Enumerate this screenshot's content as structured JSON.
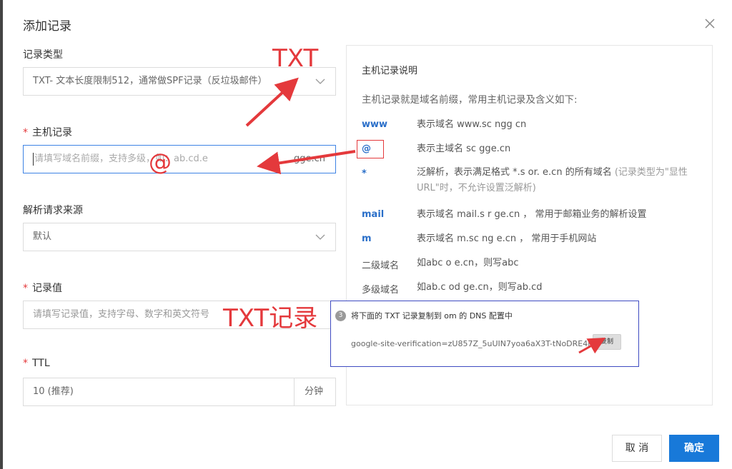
{
  "dialog": {
    "title": "添加记录"
  },
  "form": {
    "record_type": {
      "label": "记录类型",
      "value": "TXT- 文本长度限制512，通常做SPF记录（反垃圾邮件）"
    },
    "host_record": {
      "label": "主机记录",
      "placeholder": "请填写域名前缀，支持多级，如：ab.cd.e",
      "suffix": "gge.cn"
    },
    "resolve_source": {
      "label": "解析请求来源",
      "value": "默认"
    },
    "record_value": {
      "label": "记录值",
      "placeholder": "请填写记录值，支持字母、数字和英文符号"
    },
    "ttl": {
      "label": "TTL",
      "value": "10 (推荐)",
      "unit": "分钟"
    },
    "required_mark": "*"
  },
  "help": {
    "title": "主机记录说明",
    "intro": "主机记录就是域名前缀，常用主机记录及含义如下:",
    "rows": [
      {
        "key": "www",
        "desc": "表示域名 www.sc   ngg   cn"
      },
      {
        "key": "@",
        "desc": "表示主域名 sc   gge.cn"
      },
      {
        "key": "*",
        "desc": "泛解析，表示满足格式 *.s   or.   e.cn 的所有域名",
        "note": "(记录类型为\"显性URL\"时，不允许设置泛解析)"
      },
      {
        "key": "mail",
        "desc": "表示域名 mail.s    r   ge.cn ， 常用于邮箱业务的解析设置"
      },
      {
        "key": "m",
        "desc": "表示域名 m.sc   ng   e.cn ， 常用于手机网站"
      },
      {
        "key": "二级域名",
        "desc": "如abc     o      e.cn，则写abc"
      },
      {
        "key": "多级域名",
        "desc": "如ab.c     od    ge.cn，则写ab.cd"
      }
    ]
  },
  "overlay": {
    "step": "3",
    "instruction": "将下面的 TXT 记录复制到       om 的 DNS 配置中",
    "code": "google-site-verification=zU857Z_5uUIN7yoa6aX3T-tNoDRE4rS5_",
    "copy_label": "复制"
  },
  "annotations": {
    "txt": "TXT",
    "at": "@",
    "txt_record": "TXT记录"
  },
  "buttons": {
    "cancel": "取 消",
    "ok": "确定"
  },
  "colors": {
    "accent": "#1879d9",
    "required": "#e4393c",
    "annotation": "#e4393c",
    "overlay_border": "#3f4bc1",
    "help_key": "#2a6fc9"
  }
}
